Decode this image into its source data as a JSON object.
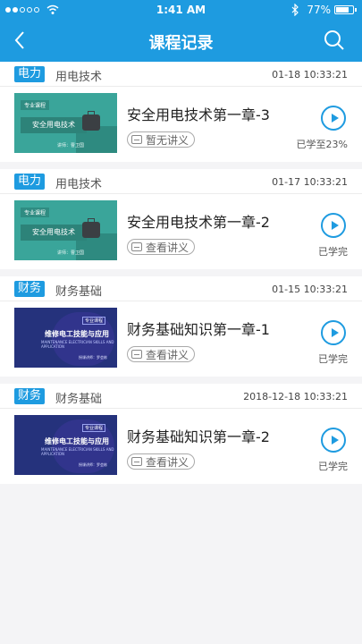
{
  "status_bar": {
    "time": "1:41 AM",
    "battery": "77%",
    "battery_level": 0.77
  },
  "header": {
    "title": "课程记录"
  },
  "records": [
    {
      "tag": "电力",
      "category": "用电技术",
      "time": "01-18 10:33:21",
      "lesson": "安全用电技术第一章-3",
      "notes": "暂无讲义",
      "progress": "已学至23%",
      "thumb": {
        "badge": "专业课程",
        "title": "安全用电技术",
        "author": "讲师：曹卫国",
        "style": "teal"
      }
    },
    {
      "tag": "电力",
      "category": "用电技术",
      "time": "01-17 10:33:21",
      "lesson": "安全用电技术第一章-2",
      "notes": "查看讲义",
      "progress": "已学完",
      "thumb": {
        "badge": "专业课程",
        "title": "安全用电技术",
        "author": "讲师：曹卫国",
        "style": "teal"
      }
    },
    {
      "tag": "财务",
      "category": "财务基础",
      "time": "01-15 10:33:21",
      "lesson": "财务基础知识第一章-1",
      "notes": "查看讲义",
      "progress": "已学完",
      "thumb": {
        "badge": "专业课程",
        "title": "维修电工技能与应用",
        "subtitle": "MAINTENANCE ELECTRICIAN SKILLS AND APPLICATION",
        "author": "授课讲师：罗会栋",
        "style": "blue"
      }
    },
    {
      "tag": "财务",
      "category": "财务基础",
      "time": "2018-12-18 10:33:21",
      "lesson": "财务基础知识第一章-2",
      "notes": "查看讲义",
      "progress": "已学完",
      "thumb": {
        "badge": "专业课程",
        "title": "维修电工技能与应用",
        "subtitle": "MAINTENANCE ELECTRICIAN SKILLS AND APPLICATION",
        "author": "授课讲师：罗会栋",
        "style": "blue"
      }
    }
  ]
}
